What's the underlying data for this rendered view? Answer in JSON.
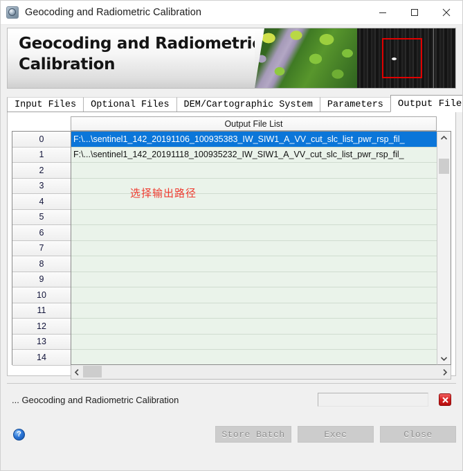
{
  "window": {
    "title": "Geocoding and Radiometric Calibration",
    "icon": "app-globe-icon",
    "controls": {
      "minimize": "minimize-icon",
      "maximize": "maximize-icon",
      "close": "close-icon"
    }
  },
  "banner": {
    "title": "Geocoding and Radiometric Calibration"
  },
  "tabs": [
    {
      "label": "Input Files",
      "active": false
    },
    {
      "label": "Optional Files",
      "active": false
    },
    {
      "label": "DEM/Cartographic System",
      "active": false
    },
    {
      "label": "Parameters",
      "active": false
    },
    {
      "label": "Output Files",
      "active": true
    }
  ],
  "table": {
    "column_header": "Output File List",
    "rows": [
      {
        "index": "0",
        "value": "F:\\...\\sentinel1_142_20191106_100935383_IW_SIW1_A_VV_cut_slc_list_pwr_rsp_fil_",
        "selected": true
      },
      {
        "index": "1",
        "value": "F:\\...\\sentinel1_142_20191118_100935232_IW_SIW1_A_VV_cut_slc_list_pwr_rsp_fil_",
        "selected": false
      },
      {
        "index": "2",
        "value": "",
        "selected": false
      },
      {
        "index": "3",
        "value": "",
        "selected": false
      },
      {
        "index": "4",
        "value": "",
        "selected": false
      },
      {
        "index": "5",
        "value": "",
        "selected": false
      },
      {
        "index": "6",
        "value": "",
        "selected": false
      },
      {
        "index": "7",
        "value": "",
        "selected": false
      },
      {
        "index": "8",
        "value": "",
        "selected": false
      },
      {
        "index": "9",
        "value": "",
        "selected": false
      },
      {
        "index": "10",
        "value": "",
        "selected": false
      },
      {
        "index": "11",
        "value": "",
        "selected": false
      },
      {
        "index": "12",
        "value": "",
        "selected": false
      },
      {
        "index": "13",
        "value": "",
        "selected": false
      },
      {
        "index": "14",
        "value": "",
        "selected": false
      }
    ]
  },
  "annotation": {
    "text": "选择输出路径",
    "color": "#ef3b30"
  },
  "status": {
    "text": "... Geocoding and Radiometric Calibration",
    "progress_value": "",
    "stop_icon": "close-x-icon"
  },
  "footer": {
    "help_icon": "help-question-icon",
    "buttons": [
      {
        "label": "Store Batch",
        "enabled": false
      },
      {
        "label": "Exec",
        "enabled": false
      },
      {
        "label": "Close",
        "enabled": false
      }
    ]
  },
  "scrollbars": {
    "vertical": {
      "up": "chevron-up-icon",
      "down": "chevron-down-icon"
    },
    "horizontal": {
      "left": "chevron-left-icon",
      "right": "chevron-right-icon"
    }
  }
}
